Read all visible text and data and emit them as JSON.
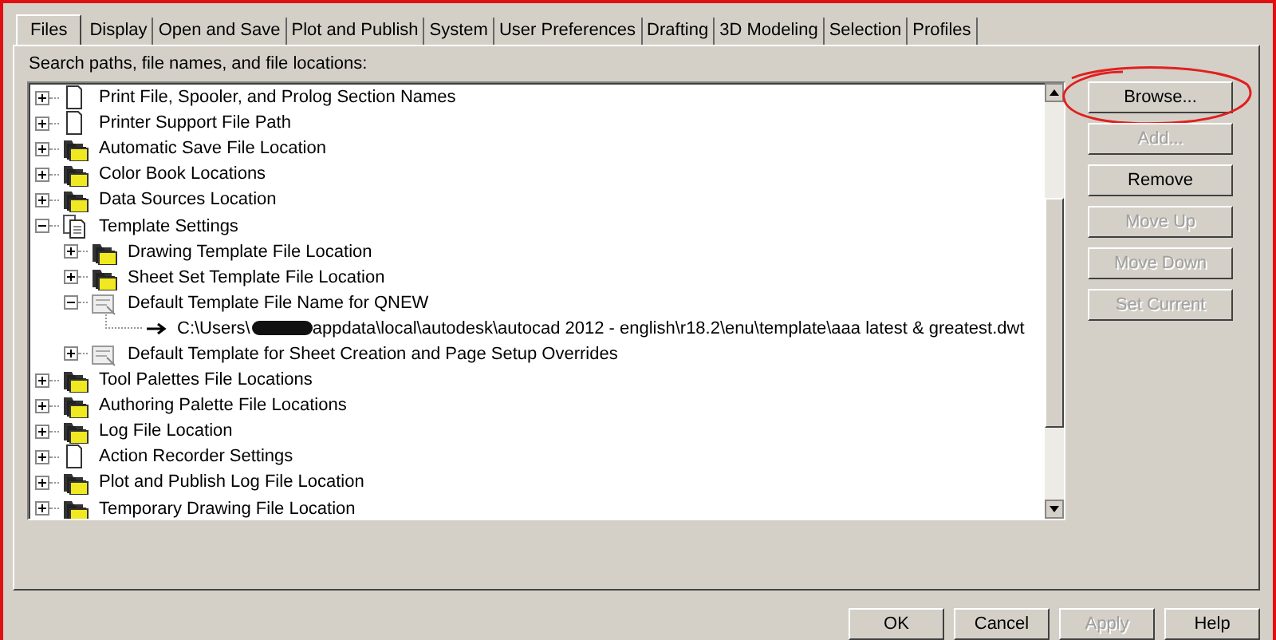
{
  "tabs": [
    {
      "label": "Files",
      "selected": true
    },
    {
      "label": "Display",
      "selected": false
    },
    {
      "label": "Open and Save",
      "selected": false
    },
    {
      "label": "Plot and Publish",
      "selected": false
    },
    {
      "label": "System",
      "selected": false
    },
    {
      "label": "User Preferences",
      "selected": false
    },
    {
      "label": "Drafting",
      "selected": false
    },
    {
      "label": "3D Modeling",
      "selected": false
    },
    {
      "label": "Selection",
      "selected": false
    },
    {
      "label": "Profiles",
      "selected": false
    }
  ],
  "tree_label": "Search paths, file names, and file locations:",
  "tree": [
    {
      "label": "Print File, Spooler, and Prolog Section Names",
      "kind": "page",
      "expanded": false
    },
    {
      "label": "Printer Support File Path",
      "kind": "page",
      "expanded": false
    },
    {
      "label": "Automatic Save File Location",
      "kind": "folder",
      "expanded": false
    },
    {
      "label": "Color Book Locations",
      "kind": "folder",
      "expanded": false
    },
    {
      "label": "Data Sources Location",
      "kind": "folder",
      "expanded": false
    },
    {
      "label": "Template Settings",
      "kind": "pages",
      "expanded": true,
      "children": [
        {
          "label": "Drawing Template File Location",
          "kind": "folder",
          "expanded": false
        },
        {
          "label": "Sheet Set Template File Location",
          "kind": "folder",
          "expanded": false
        },
        {
          "label": "Default Template File Name for QNEW",
          "kind": "template",
          "expanded": true,
          "children": [
            {
              "kind": "path",
              "label": "C:\\Users\\",
              "label_end": "appdata\\local\\autodesk\\autocad 2012 - english\\r18.2\\enu\\template\\aaa latest & greatest.dwt",
              "redacted": true
            }
          ]
        },
        {
          "label": "Default Template for Sheet Creation and Page Setup Overrides",
          "kind": "template",
          "expanded": false
        }
      ]
    },
    {
      "label": "Tool Palettes File Locations",
      "kind": "folder",
      "expanded": false
    },
    {
      "label": "Authoring Palette File Locations",
      "kind": "folder",
      "expanded": false
    },
    {
      "label": "Log File Location",
      "kind": "folder",
      "expanded": false
    },
    {
      "label": "Action Recorder Settings",
      "kind": "page",
      "expanded": false
    },
    {
      "label": "Plot and Publish Log File Location",
      "kind": "folder",
      "expanded": false
    },
    {
      "label": "Temporary Drawing File Location",
      "kind": "folder",
      "expanded": false
    }
  ],
  "side_buttons": [
    {
      "label": "Browse...",
      "disabled": false,
      "circled": true
    },
    {
      "label": "Add...",
      "disabled": true,
      "circled": false
    },
    {
      "label": "Remove",
      "disabled": false,
      "circled": false
    },
    {
      "label": "Move Up",
      "disabled": true,
      "circled": false
    },
    {
      "label": "Move Down",
      "disabled": true,
      "circled": false
    },
    {
      "label": "Set Current",
      "disabled": true,
      "circled": false
    }
  ],
  "dialog_buttons": [
    {
      "label": "OK",
      "disabled": false
    },
    {
      "label": "Cancel",
      "disabled": false
    },
    {
      "label": "Apply",
      "disabled": true
    },
    {
      "label": "Help",
      "disabled": false
    }
  ]
}
